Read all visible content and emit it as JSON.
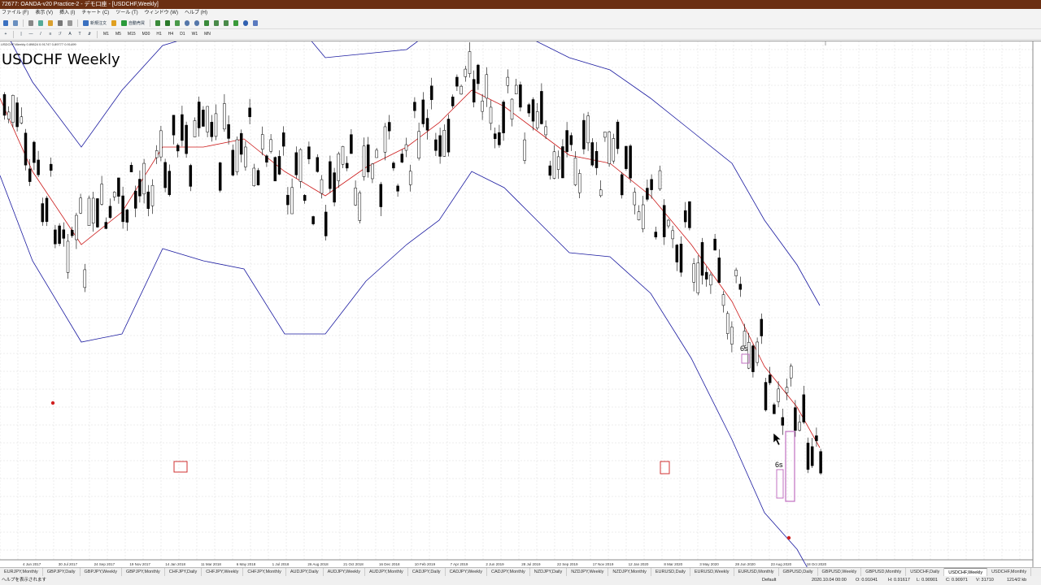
{
  "window": {
    "title": "72677: OANDA-v20 Practice-2 - デモ口座 - [USDCHF,Weekly]"
  },
  "menu": [
    "ファイル (F)",
    "表示 (V)",
    "挿入 (I)",
    "チャート (C)",
    "ツール (T)",
    "ウィンドウ (W)",
    "ヘルプ (H)"
  ],
  "toolbar": {
    "new_order_label": "新規注文",
    "auto_trade_label": "自動売買",
    "timeframes": [
      "M1",
      "M5",
      "M15",
      "M30",
      "H1",
      "H4",
      "D1",
      "W1",
      "MN"
    ]
  },
  "chart": {
    "header_text": "USDCHF,Weekly  0.89824 0.91747 0.89777 0.91499",
    "title": "USDCHF Weekly",
    "annotation_label": "6s",
    "x_ticks": [
      "4 Jun 2017",
      "30 Jul 2017",
      "24 Sep 2017",
      "19 Nov 2017",
      "14 Jan 2018",
      "11 Mar 2018",
      "6 May 2018",
      "1 Jul 2018",
      "26 Aug 2018",
      "21 Oct 2018",
      "16 Dec 2018",
      "10 Feb 2019",
      "7 Apr 2019",
      "2 Jun 2019",
      "28 Jul 2019",
      "22 Sep 2019",
      "17 Nov 2019",
      "12 Jan 2020",
      "8 Mar 2020",
      "3 May 2020",
      "28 Jun 2020",
      "23 Aug 2020",
      "18 Oct 2020"
    ],
    "colors": {
      "bull_candle": "#ffffff",
      "bear_candle": "#000000",
      "band_outer": "#1a1aa0",
      "band_mid": "#cc1a1a",
      "box_red": "#d03030",
      "box_pink": "#c070c0",
      "grid": "#d9d9d9"
    }
  },
  "tabs": {
    "items": [
      "EURJPY,Monthly",
      "GBPJPY,Daily",
      "GBPJPY,Weekly",
      "GBPJPY,Monthly",
      "CHFJPY,Daily",
      "CHFJPY,Weekly",
      "CHFJPY,Monthly",
      "AUDJPY,Daily",
      "AUDJPY,Weekly",
      "AUDJPY,Monthly",
      "CADJPY,Daily",
      "CADJPY,Weekly",
      "CADJPY,Monthly",
      "NZDJPY,Daily",
      "NZDJPY,Weekly",
      "NZDJPY,Monthly",
      "EURUSD,Daily",
      "EURUSD,Weekly",
      "EURUSD,Monthly",
      "GBPUSD,Daily",
      "GBPUSD,Weekly",
      "GBPUSD,Monthly",
      "USDCHF,Daily",
      "USDCHF,Weekly",
      "USDCHF,Monthly"
    ],
    "active": "USDCHF,Weekly"
  },
  "status": {
    "help": "ヘルプを表示されます",
    "profile": "Default",
    "datetime": "2020.10.04 00:00",
    "open": "O: 0.91041",
    "high": "H: 0.91617",
    "low": "L: 0.90901",
    "close": "C: 0.90971",
    "volume": "V: 31710",
    "traffic": "1214/2 kb"
  }
}
